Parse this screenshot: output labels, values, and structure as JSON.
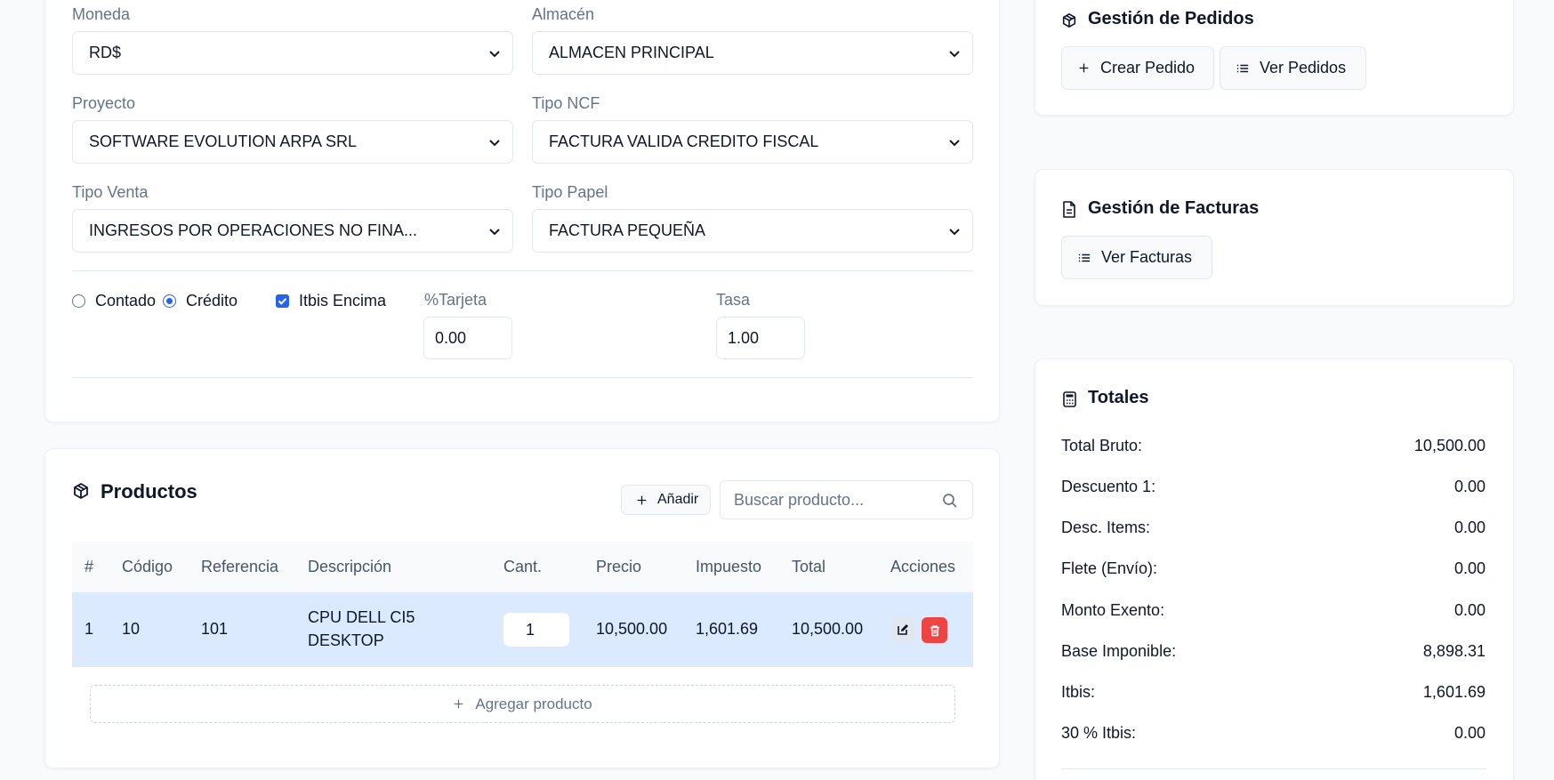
{
  "form": {
    "moneda": {
      "label": "Moneda",
      "value": "RD$"
    },
    "almacen": {
      "label": "Almacén",
      "value": "ALMACEN PRINCIPAL"
    },
    "proyecto": {
      "label": "Proyecto",
      "value": "SOFTWARE EVOLUTION ARPA SRL"
    },
    "tipo_ncf": {
      "label": "Tipo NCF",
      "value": "FACTURA VALIDA CREDITO FISCAL"
    },
    "tipo_venta": {
      "label": "Tipo Venta",
      "value": "INGRESOS POR OPERACIONES NO FINA..."
    },
    "tipo_papel": {
      "label": "Tipo Papel",
      "value": "FACTURA PEQUEÑA"
    },
    "contado_label": "Contado",
    "credito_label": "Crédito",
    "payment_selected": "Crédito",
    "itbis_encima_label": "Itbis Encima",
    "itbis_encima_checked": true,
    "tarjeta": {
      "label": "%Tarjeta",
      "value": "0.00"
    },
    "tasa": {
      "label": "Tasa",
      "value": "1.00"
    }
  },
  "productos": {
    "title": "Productos",
    "add_label": "Añadir",
    "search_placeholder": "Buscar producto...",
    "columns": [
      "#",
      "Código",
      "Referencia",
      "Descripción",
      "Cant.",
      "Precio",
      "Impuesto",
      "Total",
      "Acciones"
    ],
    "rows": [
      {
        "num": "1",
        "codigo": "10",
        "referencia": "101",
        "descripcion_l1": "CPU DELL CI5",
        "descripcion_l2": "DESKTOP",
        "cantidad": "1",
        "precio": "10,500.00",
        "impuesto": "1,601.69",
        "total": "10,500.00"
      }
    ],
    "add_row_label": "Agregar producto"
  },
  "pedidos": {
    "title": "Gestión de Pedidos",
    "crear_label": "Crear Pedido",
    "ver_label": "Ver Pedidos"
  },
  "facturas": {
    "title": "Gestión de Facturas",
    "ver_label": "Ver Facturas"
  },
  "totales": {
    "title": "Totales",
    "items": [
      {
        "label": "Total Bruto:",
        "value": "10,500.00"
      },
      {
        "label": "Descuento 1:",
        "value": "0.00"
      },
      {
        "label": "Desc. Items:",
        "value": "0.00"
      },
      {
        "label": "Flete (Envío):",
        "value": "0.00"
      },
      {
        "label": "Monto Exento:",
        "value": "0.00"
      },
      {
        "label": "Base Imponible:",
        "value": "8,898.31"
      },
      {
        "label": "Itbis:",
        "value": "1,601.69"
      },
      {
        "label": "30 % Itbis:",
        "value": "0.00"
      }
    ]
  },
  "colors": {
    "accent": "#2563eb",
    "danger": "#ef4444",
    "row_highlight": "#dbeafe",
    "header_bg": "#f8fafc"
  },
  "icons": [
    "chevron-down-icon",
    "package-icon",
    "plus-icon",
    "list-icon",
    "file-icon",
    "calculator-icon",
    "search-icon",
    "edit-icon",
    "trash-icon"
  ]
}
